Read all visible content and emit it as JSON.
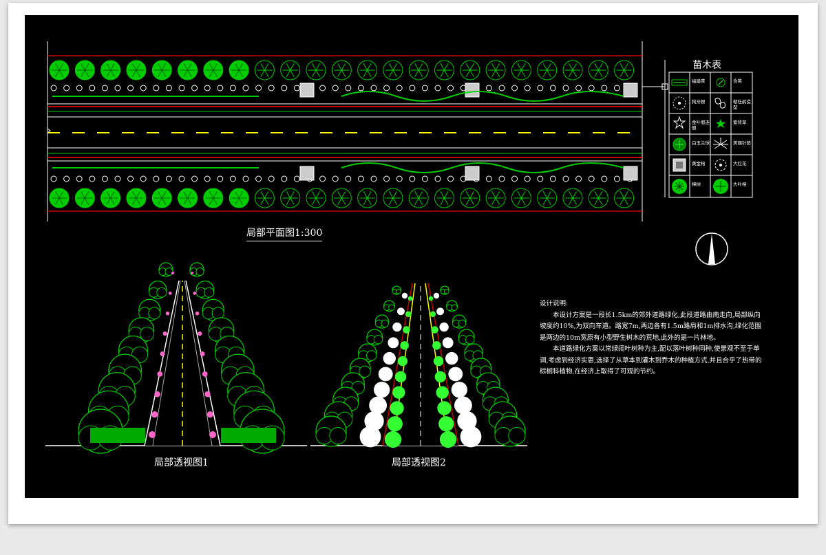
{
  "plan": {
    "title": "局部平面图1:300"
  },
  "legend": {
    "title": "苗木表",
    "items": [
      {
        "name": "福建茶",
        "icon": "hedge-icon",
        "col": 0,
        "row": 0
      },
      {
        "name": "含笑",
        "icon": "smallshrub-icon",
        "col": 1,
        "row": 0
      },
      {
        "name": "狗牙根",
        "icon": "dottedcircle-icon",
        "col": 0,
        "row": 1
      },
      {
        "name": "勒杜鹃造型",
        "icon": "flower-icon",
        "col": 1,
        "row": 1
      },
      {
        "name": "金叶假连翘",
        "icon": "star-icon",
        "col": 0,
        "row": 2
      },
      {
        "name": "紫背草",
        "icon": "smallgreen-icon",
        "col": 1,
        "row": 2
      },
      {
        "name": "白玉兰球",
        "icon": "greenleaf-icon",
        "col": 0,
        "row": 3
      },
      {
        "name": "美丽针葵",
        "icon": "palm-icon",
        "col": 1,
        "row": 3
      },
      {
        "name": "黄金榕",
        "icon": "square-shrub-icon",
        "col": 0,
        "row": 4
      },
      {
        "name": "大红花",
        "icon": "circle-icon",
        "col": 1,
        "row": 4
      },
      {
        "name": "樟树",
        "icon": "tree-icon",
        "col": 0,
        "row": 5
      },
      {
        "name": "大叶榕",
        "icon": "bigtree-icon",
        "col": 1,
        "row": 5
      }
    ]
  },
  "perspective1": {
    "title": "局部透视图1"
  },
  "perspective2": {
    "title": "局部透视图2"
  },
  "description": {
    "heading": "设计说明:",
    "paragraph1": "本设计方案是一段长1.5km的郊外道路绿化,此段道路由南走向,局部纵向坡度约10%,为双向车道。路宽7m,两边各有1.5m路肩和1m排水沟,绿化范围是两边的10m宽原有小型野生树木的荒地,此外的是一片林地。",
    "paragraph2": "本道路绿化方案以常绿阔叶树种为主,配以落叶树种同种,使景观不至于单调,考虑到经济实惠,选择了从草本到灌木到乔木的种植方式,并且合乎了热带的棕榈科植物,在经济上取得了可观的节约。"
  },
  "colors": {
    "background": "#000000",
    "tree_green": "#00cc00",
    "bright_green": "#33ff33",
    "road_red": "#cc0000",
    "centerline_yellow": "#ffff00",
    "line_white": "#ffffff"
  }
}
